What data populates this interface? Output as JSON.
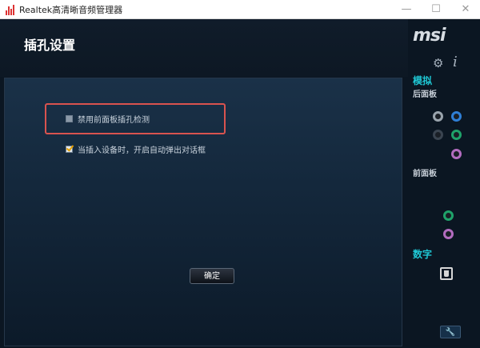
{
  "window": {
    "title": "Realtek高清晰音频管理器",
    "minimize": "—",
    "maximize": "☐",
    "close": "✕"
  },
  "header": {
    "title": "插孔设置"
  },
  "options": [
    {
      "label": "禁用前面板插孔检测",
      "checked": false
    },
    {
      "label": "当插入设备时，开启自动弹出对话框",
      "checked": true
    }
  ],
  "ok_button": {
    "label": "确定"
  },
  "sidebar": {
    "logo": "msi",
    "analog_title": "模拟",
    "rear_panel_label": "后面板",
    "front_panel_label": "前面板",
    "digital_title": "数字",
    "rear_jacks": [
      "gray",
      "blue",
      "black",
      "green",
      "pink"
    ],
    "front_jacks": [
      "green",
      "pink"
    ]
  },
  "colors": {
    "accent": "#1fc7d4",
    "highlight_border": "#d9534f",
    "jack_gray": "#9aa4ad",
    "jack_blue": "#2f7fd6",
    "jack_black": "#3a4450",
    "jack_green": "#1fa36a",
    "jack_pink": "#b36cc0"
  }
}
